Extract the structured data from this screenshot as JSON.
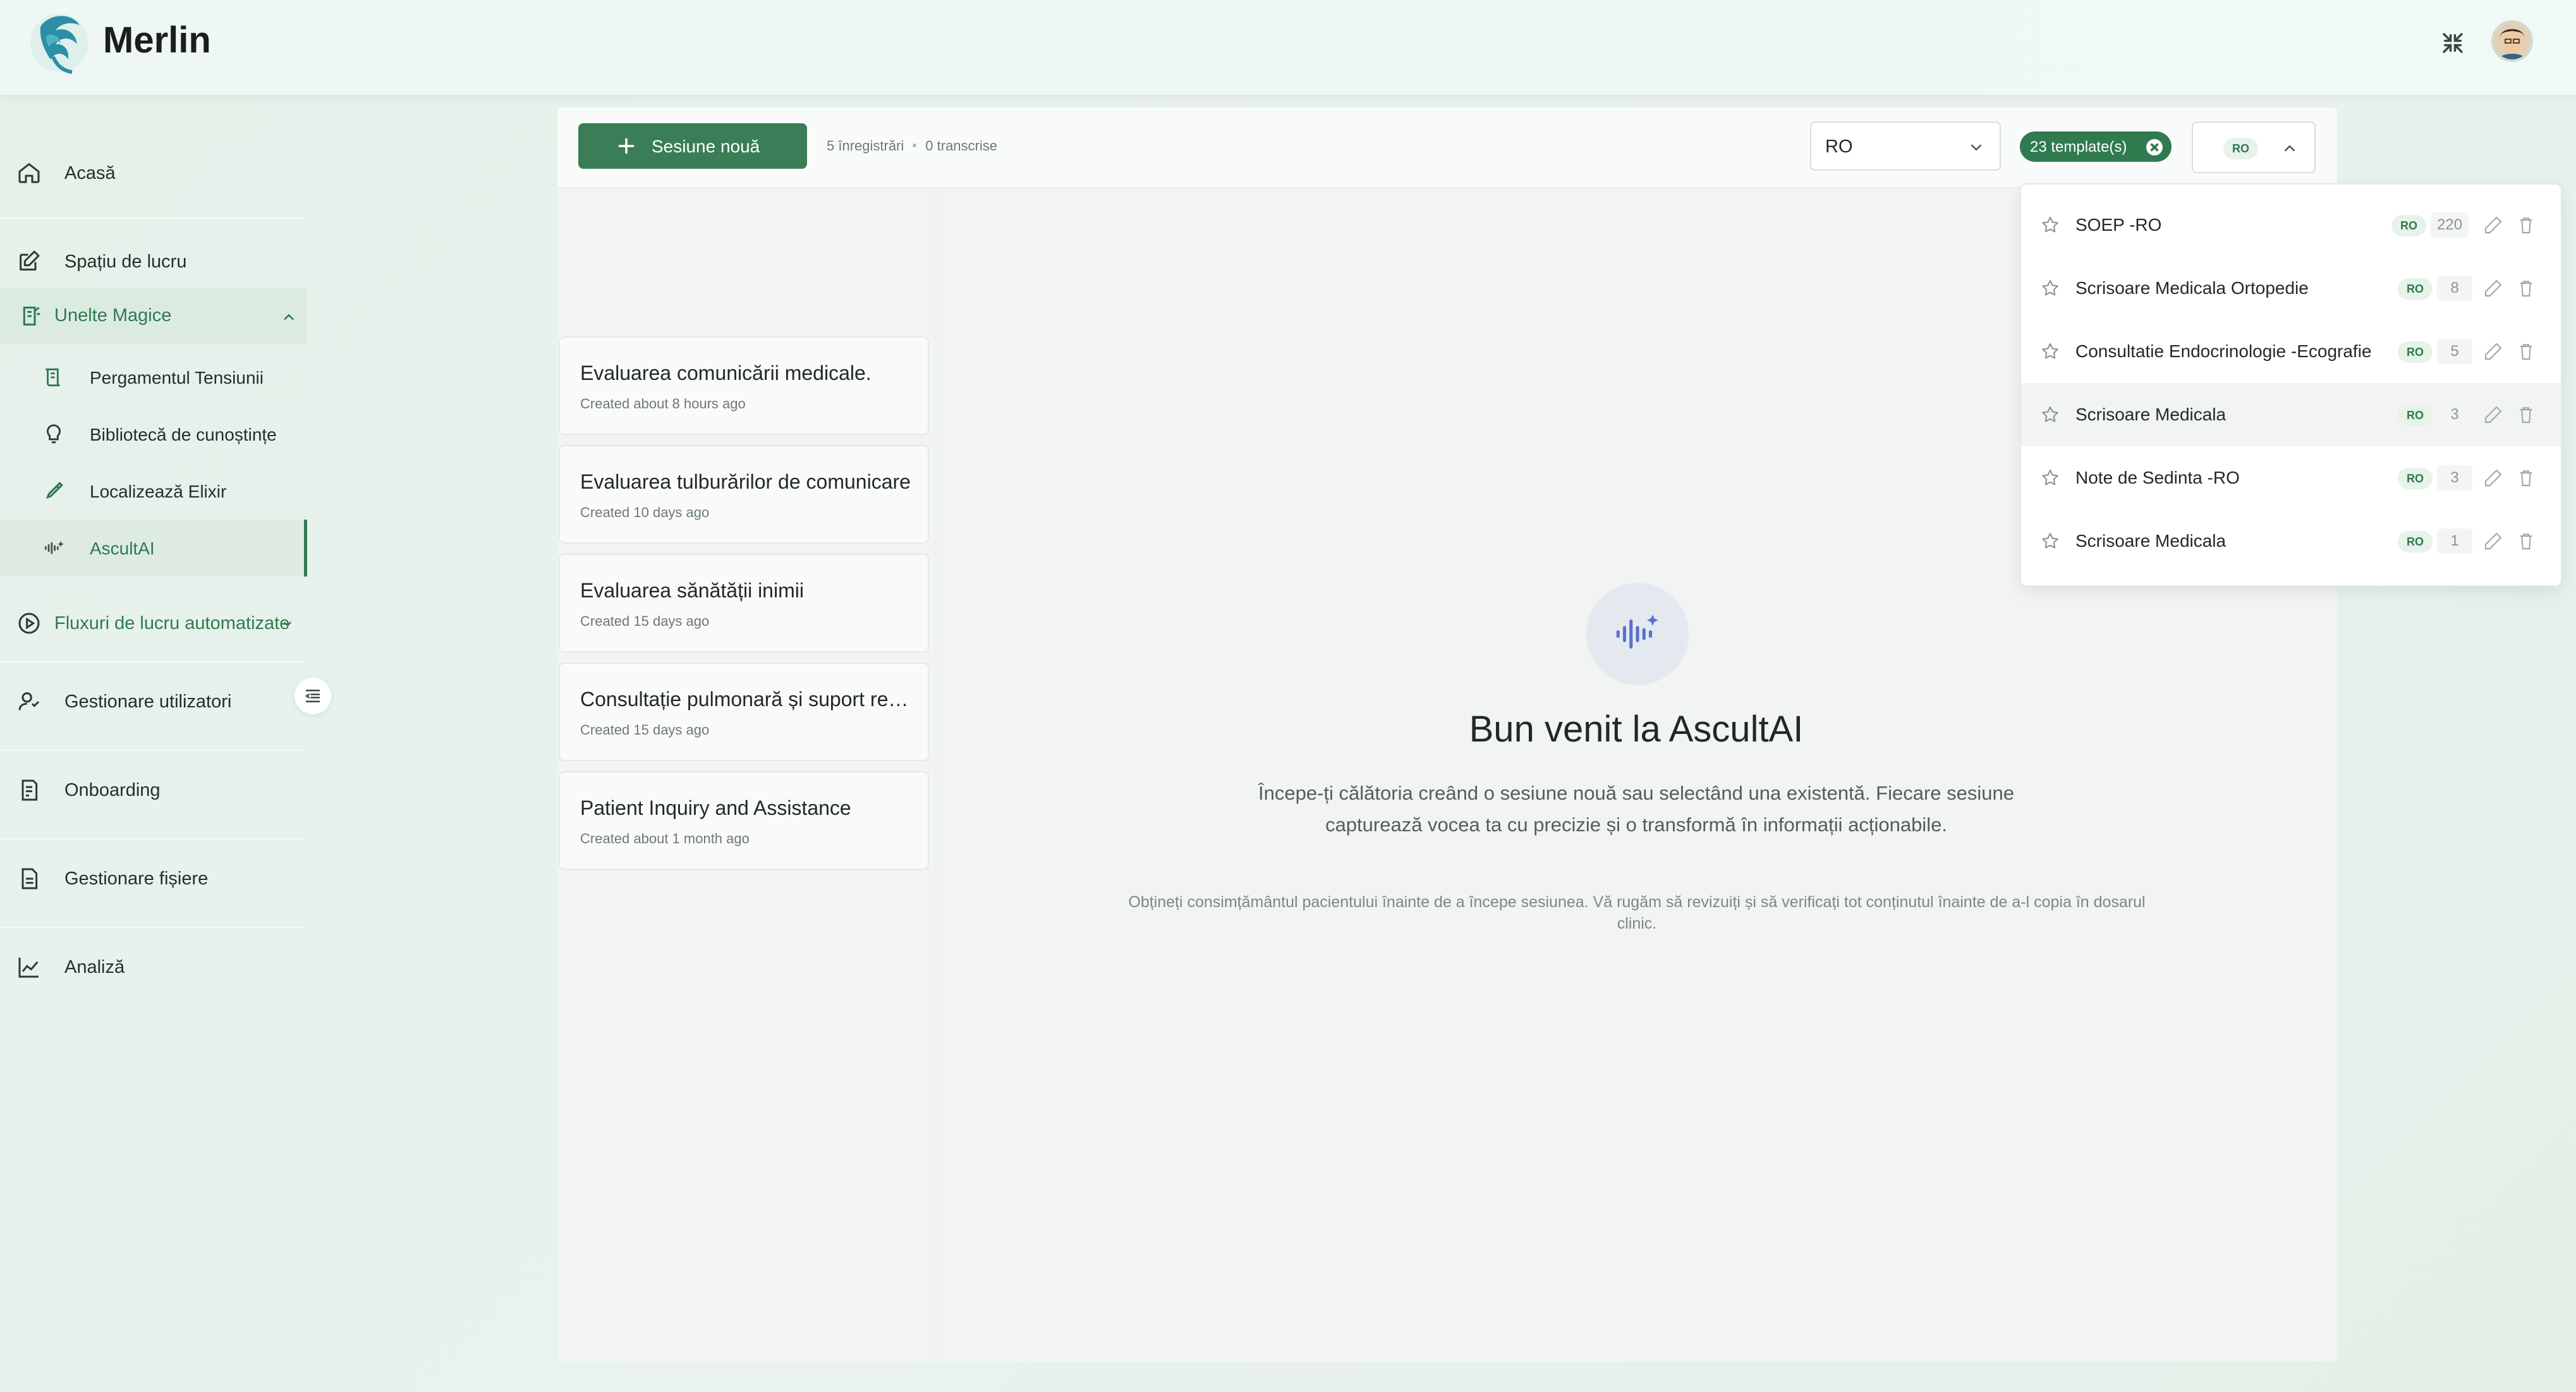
{
  "app": {
    "name": "Merlin"
  },
  "colors": {
    "accent": "#2f7a4f",
    "primary_button": "#3a7d56",
    "background": "#e8f1ec"
  },
  "header": {
    "actions": [
      "collapse-icon",
      "user-avatar"
    ]
  },
  "sidebar": {
    "items": [
      {
        "label": "Acasă",
        "icon": "home-icon"
      },
      {
        "label": "Spațiu de lucru",
        "icon": "edit-icon"
      }
    ],
    "group": {
      "label": "Unelte Magice",
      "icon": "magic-tools-icon",
      "children": [
        {
          "label": "Pergamentul Tensiunii",
          "icon": "scroll-icon"
        },
        {
          "label": "Bibliotecă de cunoștințe",
          "icon": "lightbulb-icon"
        },
        {
          "label": "Localizează Elixir",
          "icon": "pipette-icon"
        },
        {
          "label": "AscultAI",
          "icon": "audio-wave-icon",
          "active": true
        }
      ]
    },
    "items_after": [
      {
        "label": "Fluxuri de lucru automatizate",
        "icon": "play-circle-icon"
      },
      {
        "label": "Gestionare utilizatori",
        "icon": "users-icon"
      },
      {
        "label": "Onboarding",
        "icon": "onboarding-icon"
      },
      {
        "label": "Gestionare fișiere",
        "icon": "files-icon"
      },
      {
        "label": "Analiză",
        "icon": "chart-icon"
      }
    ]
  },
  "toolbar": {
    "new_session_label": "Sesiune nouă",
    "recordings": "5 înregistrări",
    "transcribed": "0 transcrise",
    "language_value": "RO",
    "templates_chip": "23 template(s)",
    "template_select_badge": "RO"
  },
  "sessions": [
    {
      "title": "Evaluarea comunicării medicale.",
      "created": "Created about 8 hours ago"
    },
    {
      "title": "Evaluarea tulburărilor de comunicare",
      "created": "Created 10 days ago"
    },
    {
      "title": "Evaluarea sănătății inimii",
      "created": "Created 15 days ago"
    },
    {
      "title": "Consultație pulmonară și suport respirator",
      "created": "Created 15 days ago"
    },
    {
      "title": "Patient Inquiry and Assistance",
      "created": "Created about 1 month ago"
    }
  ],
  "welcome": {
    "title": "Bun venit la AscultAI",
    "subtitle": "Începe-ți călătoria creând o sesiune nouă sau selectând una existentă. Fiecare sesiune capturează vocea ta cu precizie și o transformă în informații acționabile.",
    "note": "Obțineți consimțământul pacientului înainte de a începe sesiunea. Vă rugăm să revizuiți și să verificați tot conținutul înainte de a-l copia în dosarul clinic."
  },
  "templates": [
    {
      "name": "SOEP -RO",
      "lang": "RO",
      "count": "220"
    },
    {
      "name": "Scrisoare Medicala Ortopedie",
      "lang": "RO",
      "count": "8"
    },
    {
      "name": "Consultatie Endocrinologie -Ecografie",
      "lang": "RO",
      "count": "5"
    },
    {
      "name": "Scrisoare Medicala",
      "lang": "RO",
      "count": "3",
      "highlighted": true
    },
    {
      "name": "Note de Sedinta -RO",
      "lang": "RO",
      "count": "3"
    },
    {
      "name": "Scrisoare Medicala",
      "lang": "RO",
      "count": "1"
    }
  ]
}
